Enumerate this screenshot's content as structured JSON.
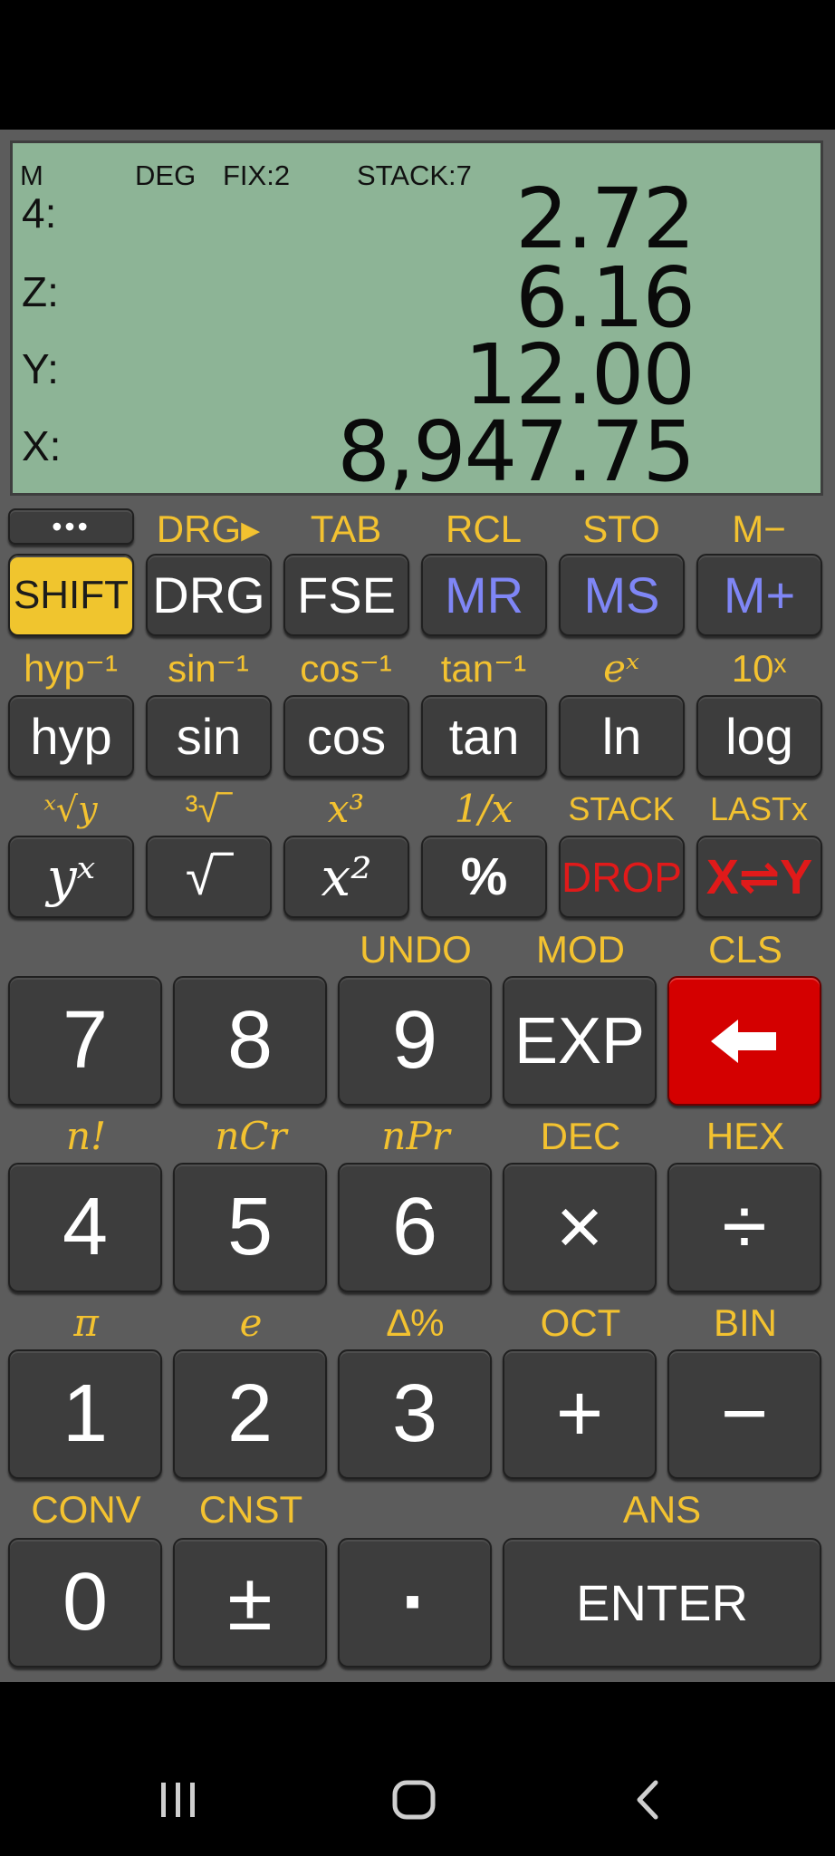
{
  "lcd": {
    "status": {
      "memory": "M",
      "angle": "DEG",
      "format": "FIX:2",
      "stack": "STACK:7"
    },
    "registers": [
      {
        "label": "4:",
        "value": "2.72"
      },
      {
        "label": "Z:",
        "value": "6.16"
      },
      {
        "label": "Y:",
        "value": "12.00"
      },
      {
        "label": "X:",
        "value": "8,947.75"
      }
    ]
  },
  "rows": [
    {
      "labels": [
        "",
        "DRG▸",
        "TAB",
        "RCL",
        "STO",
        "M−"
      ],
      "keys": [
        "SHIFT",
        "DRG",
        "FSE",
        "MR",
        "MS",
        "M+"
      ]
    },
    {
      "labels": [
        "hyp⁻¹",
        "sin⁻¹",
        "cos⁻¹",
        "tan⁻¹",
        "eˣ",
        "10ˣ"
      ],
      "keys": [
        "hyp",
        "sin",
        "cos",
        "tan",
        "ln",
        "log"
      ]
    },
    {
      "labels": [
        "ˣ√y",
        "³√‾",
        "x³",
        "1/x",
        "STACK",
        "LASTx"
      ],
      "keys": [
        "yˣ",
        "√‾",
        "x²",
        "%",
        "DROP",
        "X⇌Y"
      ]
    },
    {
      "labels": [
        "",
        "",
        "UNDO",
        "MOD",
        "CLS"
      ],
      "keys": [
        "7",
        "8",
        "9",
        "EXP",
        "🡐"
      ]
    },
    {
      "labels": [
        "n!",
        "nCr",
        "nPr",
        "DEC",
        "HEX"
      ],
      "keys": [
        "4",
        "5",
        "6",
        "×",
        "÷"
      ]
    },
    {
      "labels": [
        "π",
        "e",
        "∆%",
        "OCT",
        "BIN"
      ],
      "keys": [
        "1",
        "2",
        "3",
        "+",
        "−"
      ]
    },
    {
      "labels": [
        "CONV",
        "CNST",
        "",
        "ANS"
      ],
      "keys": [
        "0",
        "±",
        "·",
        "ENTER"
      ]
    }
  ],
  "menu_button": "•••",
  "colors": {
    "shift": "#f0c52e",
    "accent_label": "#f3c230",
    "memory_key_text": "#7f86f6",
    "drop_text": "#e01a1a",
    "backspace": "#d40000",
    "lcd": "#8db496"
  },
  "nav": {
    "recents": "recents-icon",
    "home": "home-icon",
    "back": "back-icon"
  }
}
